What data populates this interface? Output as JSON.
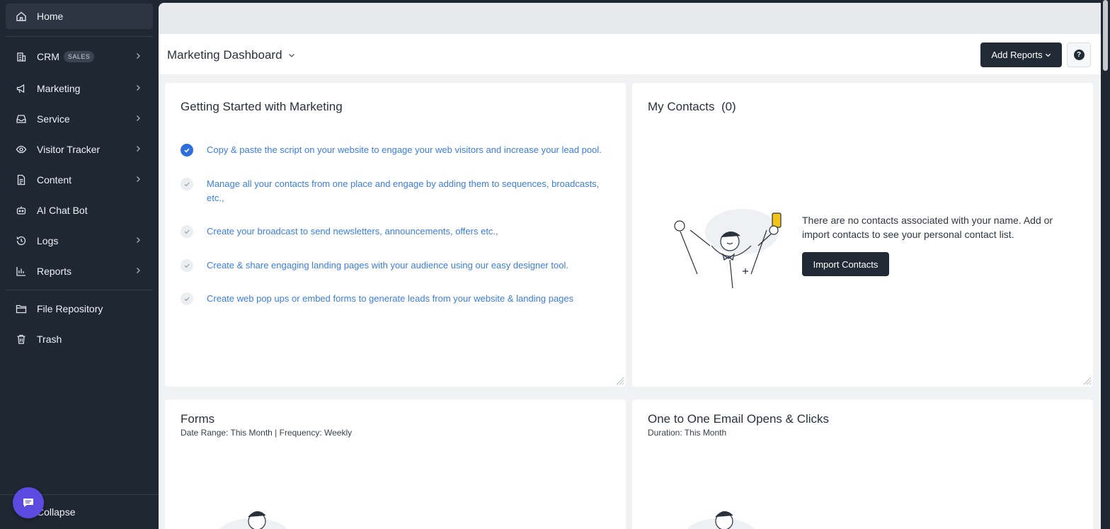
{
  "sidebar": {
    "items": [
      {
        "label": "Home",
        "icon": "home-icon"
      },
      {
        "label": "CRM",
        "badge": "SALES",
        "icon": "building-icon"
      },
      {
        "label": "Marketing",
        "icon": "megaphone-icon"
      },
      {
        "label": "Service",
        "icon": "inbox-icon"
      },
      {
        "label": "Visitor Tracker",
        "icon": "eye-icon"
      },
      {
        "label": "Content",
        "icon": "document-icon"
      },
      {
        "label": "AI Chat Bot",
        "icon": "bot-icon"
      },
      {
        "label": "Logs",
        "icon": "history-icon"
      },
      {
        "label": "Reports",
        "icon": "bar-chart-icon"
      },
      {
        "label": "File Repository",
        "icon": "folder-icon"
      },
      {
        "label": "Trash",
        "icon": "trash-icon"
      }
    ],
    "collapse_label": "Collapse"
  },
  "header": {
    "title": "Marketing Dashboard",
    "add_reports_label": "Add Reports",
    "help_label": "?"
  },
  "getting_started": {
    "title": "Getting Started with Marketing",
    "tasks": [
      {
        "text": "Copy & paste the script on your website to engage your web visitors and increase your lead pool.",
        "done": true
      },
      {
        "text": "Manage all your contacts from one place and engage by adding them to sequences, broadcasts, etc.,",
        "done": false
      },
      {
        "text": "Create your broadcast to send newsletters, announcements, offers etc.,",
        "done": false
      },
      {
        "text": "Create & share engaging landing pages with your audience using our easy designer tool.",
        "done": false
      },
      {
        "text": "Create web pop ups or embed forms to generate leads from your website & landing pages",
        "done": false
      }
    ]
  },
  "my_contacts": {
    "title": "My Contacts",
    "count": "(0)",
    "empty_message": "There are no contacts associated with your name. Add or import contacts to see your personal contact list.",
    "import_label": "Import Contacts"
  },
  "forms": {
    "title": "Forms",
    "subtitle": "Date Range: This Month | Frequency: Weekly"
  },
  "email_opens": {
    "title": "One to One Email Opens & Clicks",
    "subtitle": "Duration: This Month"
  },
  "colors": {
    "sidebar_bg": "#1f2733",
    "accent_blue": "#2e6fe0",
    "link_blue": "#3b7de0",
    "dark_button": "#222a36",
    "chat_purple": "#5b4be0"
  }
}
